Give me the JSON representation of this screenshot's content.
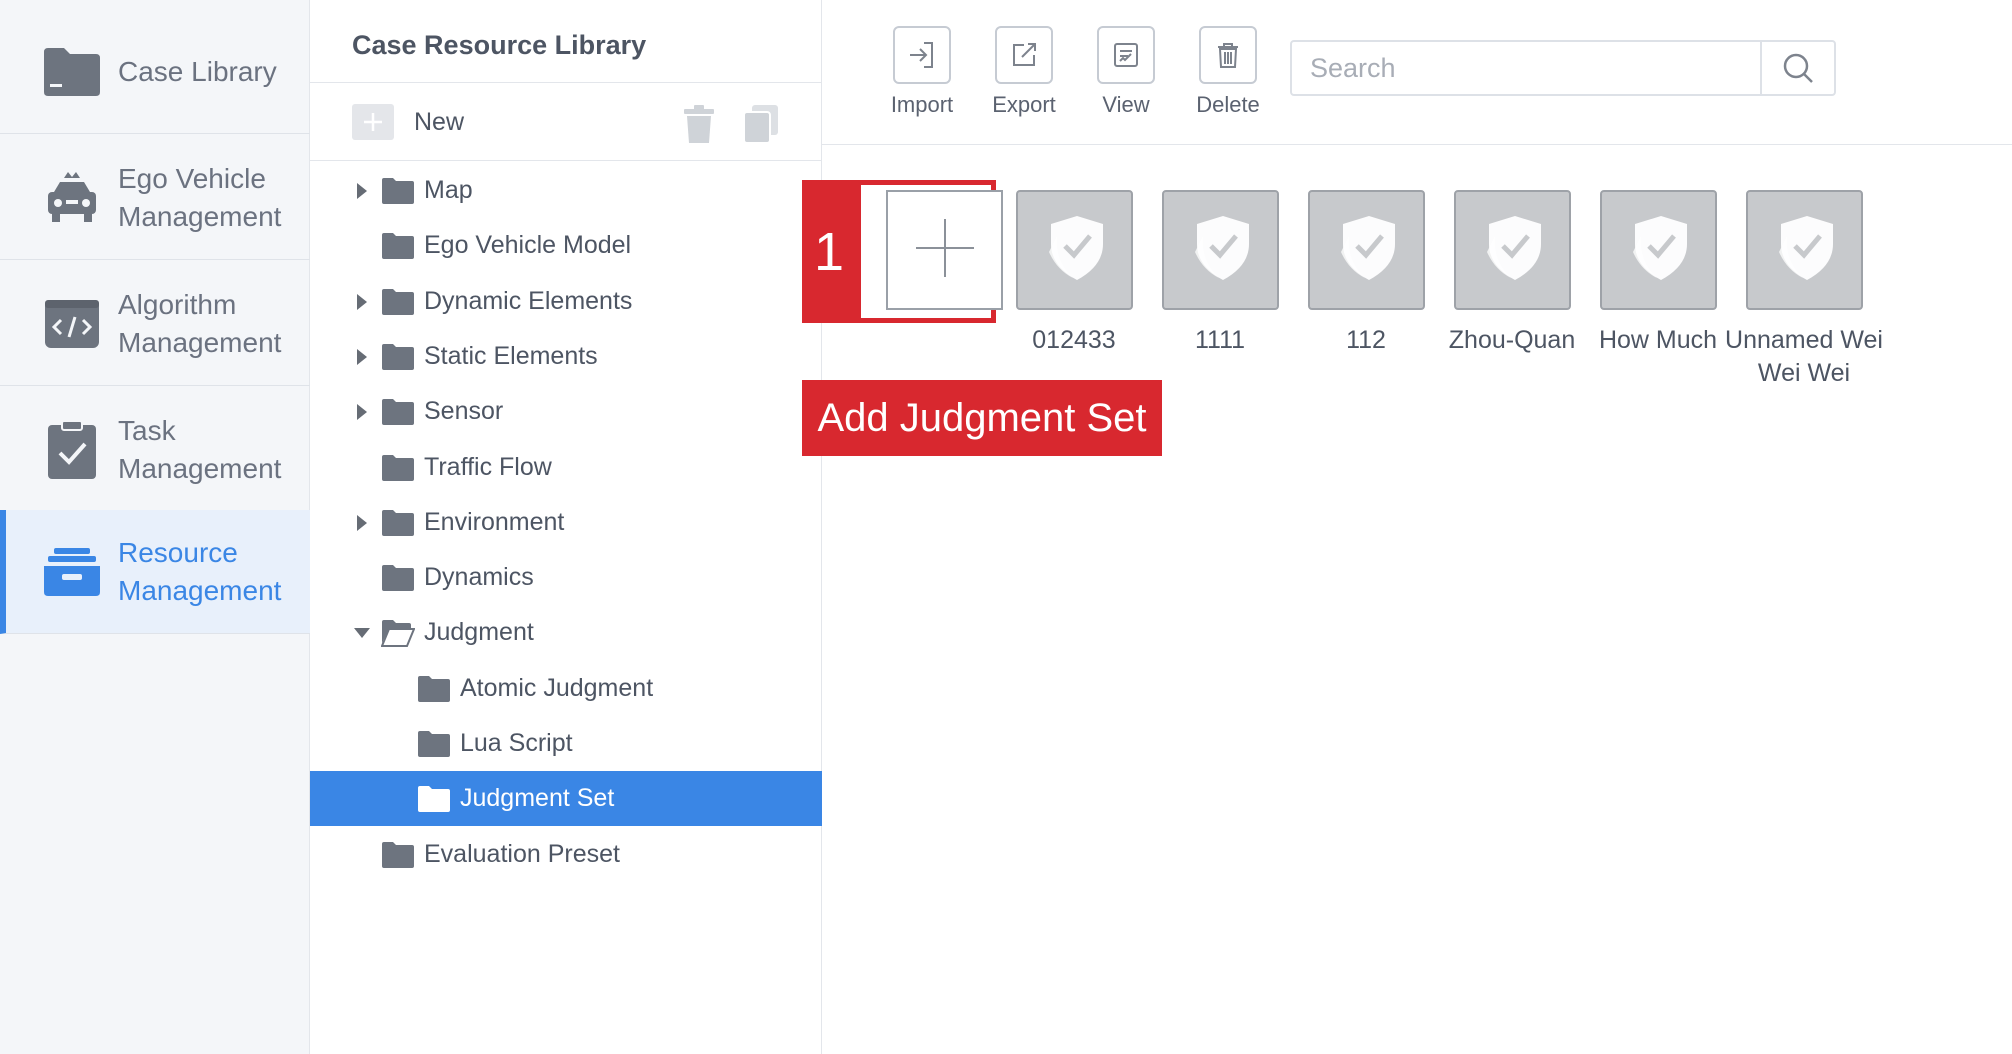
{
  "nav": {
    "items": [
      {
        "label": "Case Library",
        "icon": "folder-icon"
      },
      {
        "label": "Ego Vehicle Management",
        "icon": "car-icon"
      },
      {
        "label": "Algorithm Management",
        "icon": "code-icon"
      },
      {
        "label": "Task Management",
        "icon": "clipboard-check-icon"
      },
      {
        "label": "Resource Management",
        "icon": "resource-box-icon",
        "active": true
      }
    ],
    "accent_color": "#3a86e5"
  },
  "tree": {
    "title": "Case Resource Library",
    "new_label": "New",
    "items": [
      {
        "label": "Map",
        "level": 0,
        "expandable": true,
        "expanded": false
      },
      {
        "label": "Ego Vehicle Model",
        "level": 0,
        "expandable": false
      },
      {
        "label": "Dynamic Elements",
        "level": 0,
        "expandable": true,
        "expanded": false
      },
      {
        "label": "Static Elements",
        "level": 0,
        "expandable": true,
        "expanded": false
      },
      {
        "label": "Sensor",
        "level": 0,
        "expandable": true,
        "expanded": false
      },
      {
        "label": "Traffic Flow",
        "level": 0,
        "expandable": false
      },
      {
        "label": "Environment",
        "level": 0,
        "expandable": true,
        "expanded": false
      },
      {
        "label": "Dynamics",
        "level": 0,
        "expandable": false
      },
      {
        "label": "Judgment",
        "level": 0,
        "expandable": true,
        "expanded": true
      },
      {
        "label": "Atomic Judgment",
        "level": 1,
        "expandable": false
      },
      {
        "label": "Lua Script",
        "level": 1,
        "expandable": false
      },
      {
        "label": "Judgment Set",
        "level": 1,
        "expandable": false,
        "selected": true
      },
      {
        "label": "Evaluation Preset",
        "level": 0,
        "expandable": false
      }
    ]
  },
  "toolbar": {
    "import_label": "Import",
    "export_label": "Export",
    "view_label": "View",
    "delete_label": "Delete"
  },
  "search": {
    "placeholder": "Search",
    "value": ""
  },
  "callout": {
    "number": "1",
    "label": "Add Judgment Set",
    "color": "#d8282f"
  },
  "items": [
    {
      "label": "012433"
    },
    {
      "label": "1111"
    },
    {
      "label": "112"
    },
    {
      "label": "Zhou-Quan"
    },
    {
      "label": "How Much"
    },
    {
      "label": "Unnamed Wei Wei Wei"
    }
  ]
}
